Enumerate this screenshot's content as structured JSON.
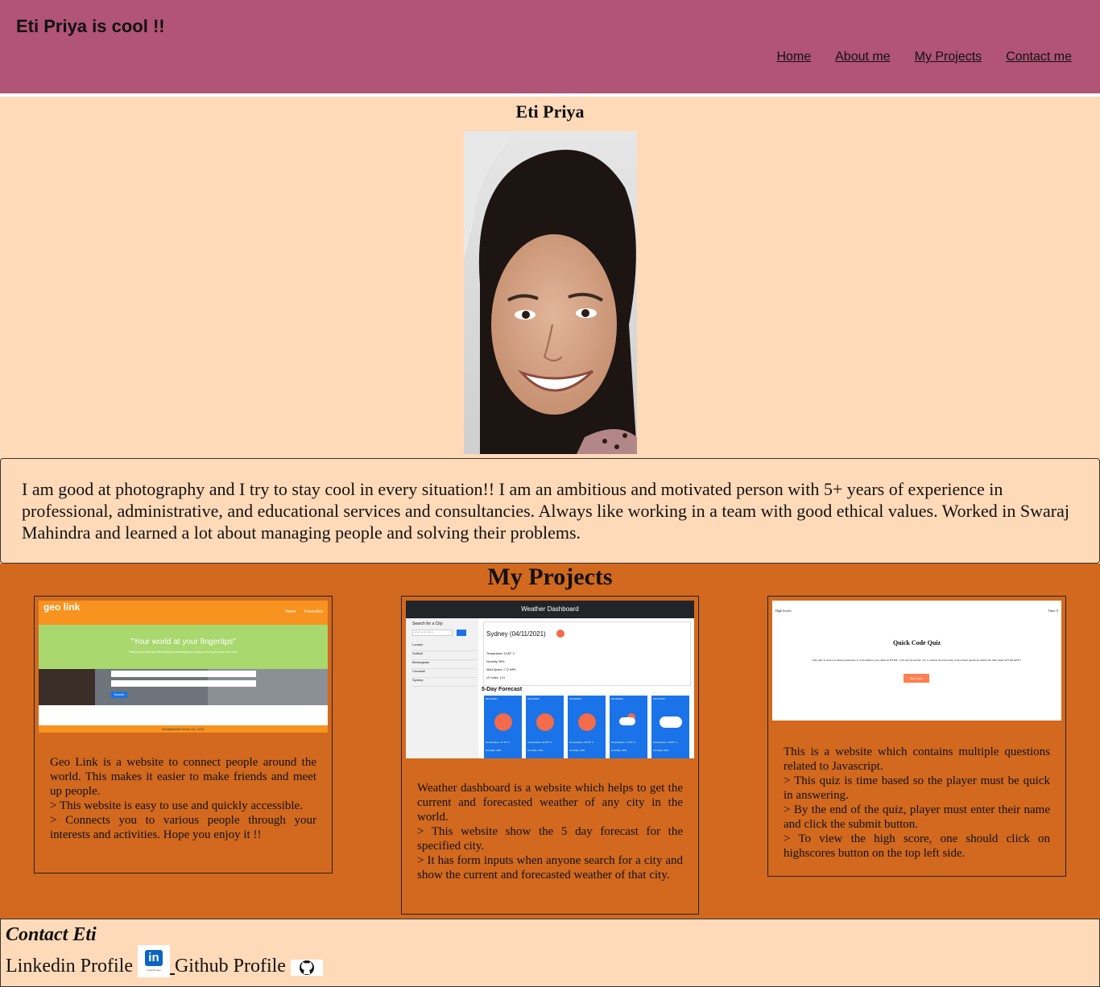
{
  "header": {
    "title": "Eti Priya is cool !!",
    "nav": [
      "Home",
      "About me",
      "My Projects",
      "Contact me"
    ]
  },
  "profile": {
    "name": "Eti Priya",
    "about": "I am good at photography and I try to stay cool in every situation!! I am an ambitious and motivated person with 5+ years of experience in professional, administrative, and educational services and consultancies. Always like working in a team with good ethical values. Worked in Swaraj Mahindra and learned a lot about managing people and solving their problems."
  },
  "projects": {
    "title": "My Projects",
    "geolink": {
      "logo": "geo link",
      "nav_home": "Home",
      "nav_fav": "Favourites",
      "tagline": "\"Your world at your fingertips\"",
      "subtitle": "Welcome to GeoLink! Find friends by entering your location or the spot name and more",
      "footer": "info@geolink.net.au Inc. 2021",
      "search_label": "Search",
      "desc": [
        "Geo Link is a website to connect people around the world. This makes it easier to make friends and meet up people.",
        "> This website is easy to use and quickly accessible.",
        "> Connects you to various people through your interests and activities. Hope you enjoy it !!"
      ]
    },
    "weather": {
      "app_title": "Weather Dashboard",
      "search_label": "Search for a City:",
      "search_placeholder": "Enter a city name",
      "cities": [
        "London",
        "Solihull",
        "Birmingham",
        "Cornwall",
        "Sydney"
      ],
      "current_title": "Sydney (04/11/2021)",
      "current_stats": [
        "Temperature: 19.82° C",
        "Humidity: 58%",
        "Wind Speed: 7.72 MPH",
        "UV Index: 1.01"
      ],
      "forecast_title": "5-Day Forecast",
      "forecast": [
        {
          "date": "04/13/2021",
          "temp": "Temperature: 17.79° C",
          "hum": "Humidity: 49%",
          "icon": "sun"
        },
        {
          "date": "04/14/2021",
          "temp": "Temperature: 22.08° C",
          "hum": "Humidity: 24%",
          "icon": "sun"
        },
        {
          "date": "04/15/2021",
          "temp": "Temperature: 20.03° C",
          "hum": "Humidity: 40%",
          "icon": "sun"
        },
        {
          "date": "04/16/2021",
          "temp": "Temperature: 17.52° C",
          "hum": "Humidity: 60%",
          "icon": "cloud-sun"
        },
        {
          "date": "04/17/2021",
          "temp": "Temperature: 16.87° C",
          "hum": "Humidity: 52%",
          "icon": "cloud"
        }
      ],
      "desc": [
        "Weather dashboard is a website which helps to get the current and forecasted weather of any city in the world.",
        "> This website show the 5 day forecast for the specified city.",
        "> It has form inputs when anyone search for a city and show the current and forecasted weather of that city."
      ]
    },
    "quiz": {
      "highscores": "High Scores",
      "timer": "Time: 0",
      "title": "Quick Code Quiz",
      "intro": "This quiz is based on simple questions. It will enhance your skills in HTML, CSS and javascript. Try to answer the following code related questions within the time limit GET READY!!",
      "start": "Start Quiz",
      "desc": [
        "This is a website which contains multiple questions related to Javascript.",
        "> This quiz is time based so the player must be quick in answering.",
        "> By the end of the quiz, player must enter their name and click the submit button.",
        "> To view the high score, one should click on highscores button on the top left side."
      ]
    }
  },
  "contact": {
    "title": "Contact Eti",
    "linkedin_label": "Linkedin Profile",
    "linkedin_icon_text": "in",
    "linkedin_caption": "LinkedIn logo",
    "github_label": "Github Profile"
  },
  "colors": {
    "header": "#b15475",
    "page": "#ffdab9",
    "projects": "#d2691e",
    "geolink_orange": "#f7931e",
    "geolink_green": "#a8d86e",
    "weather_blue": "#1a73e8",
    "weather_dark": "#212529",
    "sun": "#f26b4a",
    "quiz_button": "#ff7f50",
    "linkedin": "#0a66c2"
  }
}
